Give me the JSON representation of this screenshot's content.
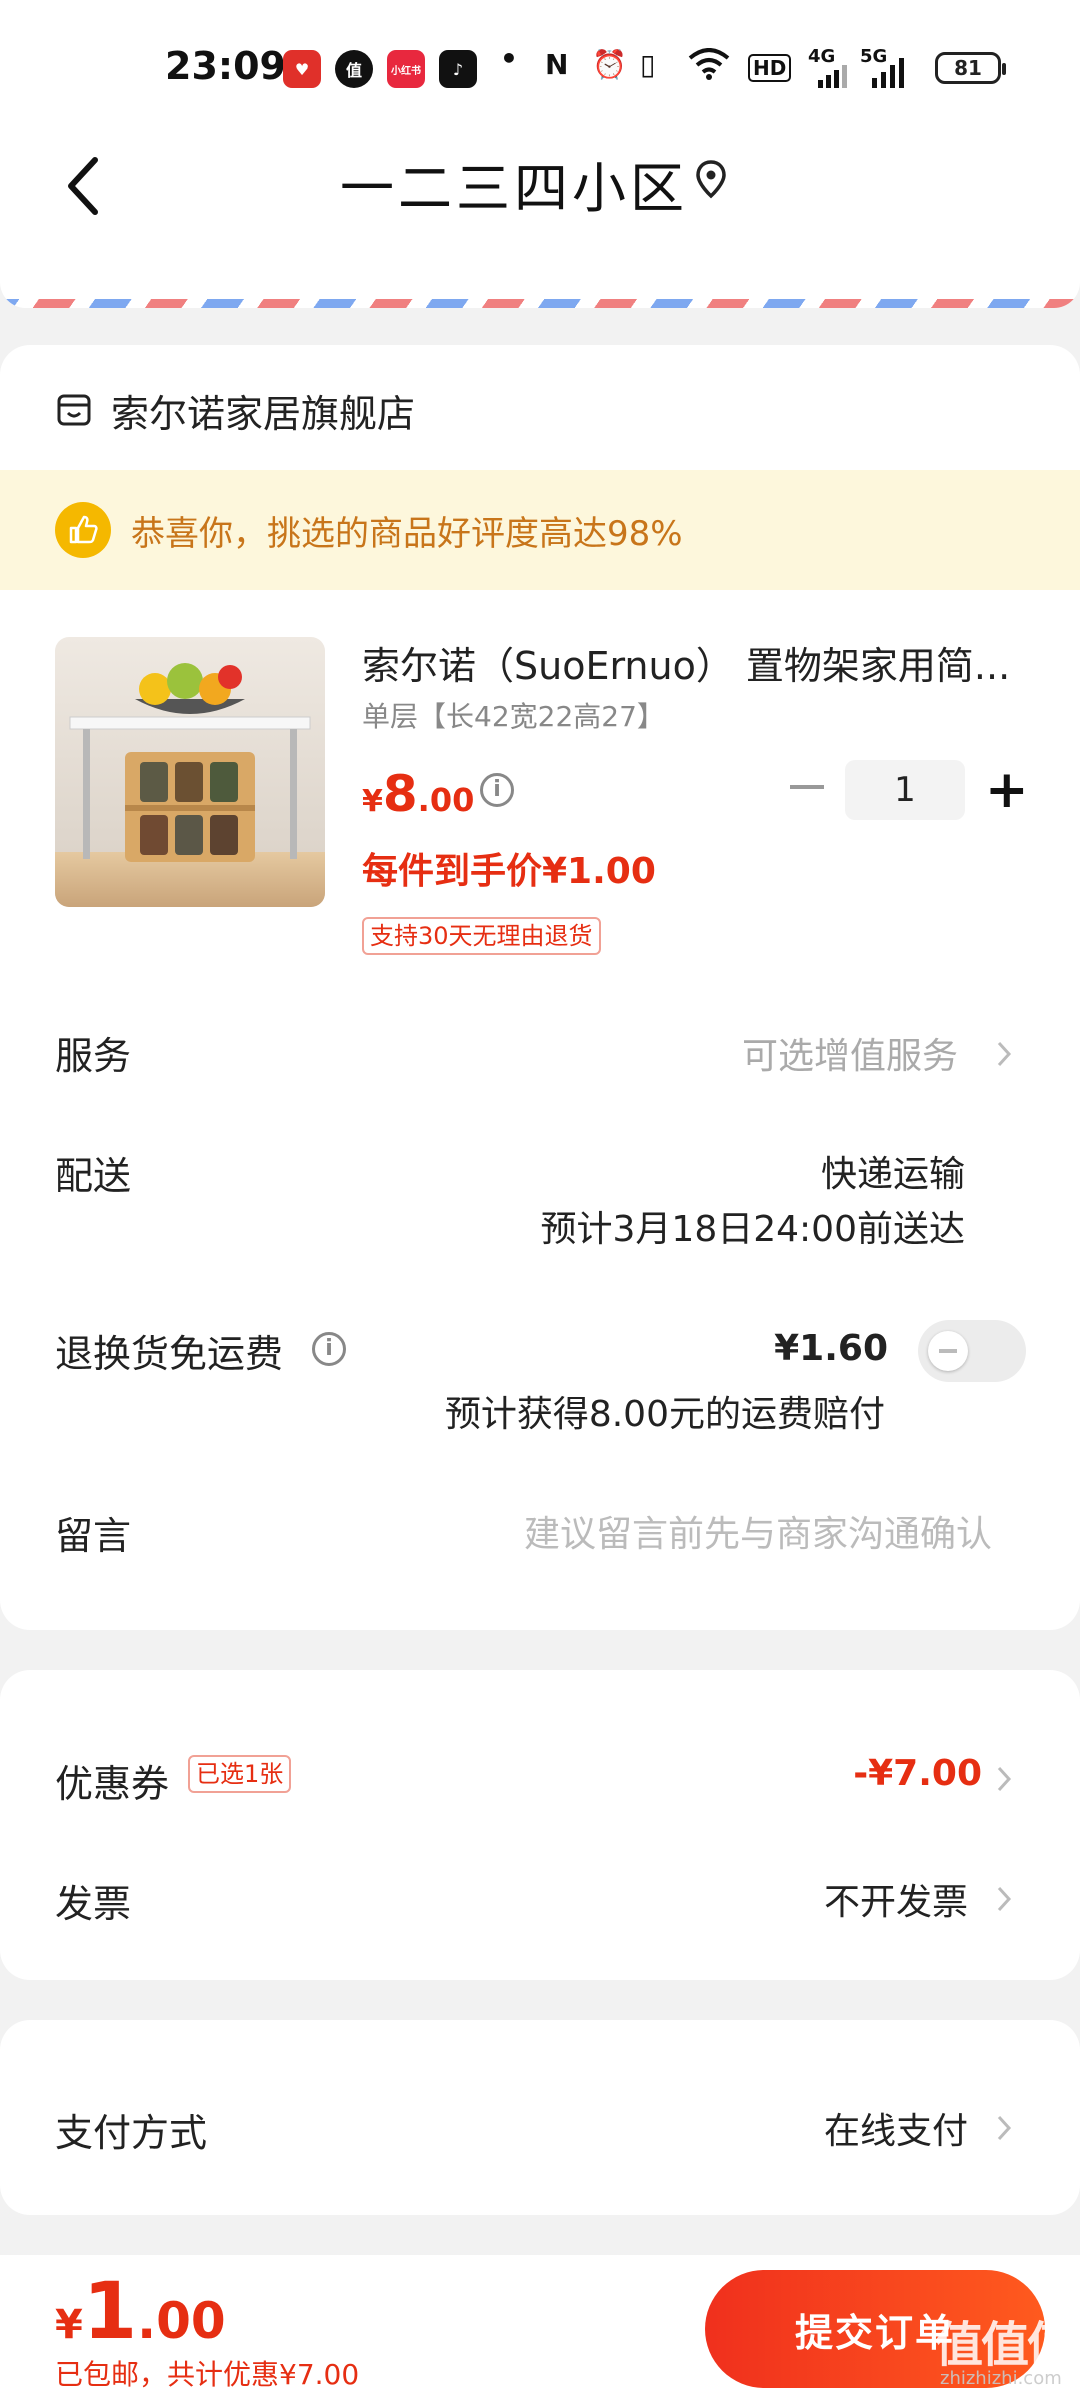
{
  "status_bar": {
    "time": "23:09",
    "apps": [
      "heart-app-icon",
      "zhi-app-icon",
      "xiaohongshu-app-icon",
      "tiktok-app-icon"
    ],
    "app_zhi_label": "值",
    "app_xhs_label": "小红书",
    "network_4g": "4G",
    "network_5g": "5G",
    "hd_label": "HD",
    "battery": "81"
  },
  "header": {
    "title": "一二三四小区"
  },
  "store": {
    "name": "索尔诺家居旗舰店",
    "praise": "恭喜你，挑选的商品好评度高达98%"
  },
  "product": {
    "title": "索尔诺（SuoErnuo） 置物架家用简...",
    "spec": "单层【长42宽22高27】",
    "price_symbol": "¥",
    "price_int": "8",
    "price_dec": ".00",
    "quantity": "1",
    "final_price": "每件到手价¥1.00",
    "return_tag": "支持30天无理由退货"
  },
  "rows": {
    "service_label": "服务",
    "service_value": "可选增值服务",
    "delivery_label": "配送",
    "delivery_method": "快递运输",
    "delivery_eta": "预计3月18日24:00前送达",
    "return_shipping_label": "退换货免运费",
    "return_shipping_price": "¥1.60",
    "return_shipping_note": "预计获得8.00元的运费赔付",
    "message_label": "留言",
    "message_placeholder": "建议留言前先与商家沟通确认"
  },
  "coupon": {
    "label": "优惠券",
    "selected_tag": "已选1张",
    "value": "-¥7.00",
    "invoice_label": "发票",
    "invoice_value": "不开发票"
  },
  "payment": {
    "label": "支付方式",
    "value": "在线支付"
  },
  "bottom": {
    "total_symbol": "¥",
    "total_int": "1",
    "total_dec": ".00",
    "note": "已包邮，共计优惠¥7.00",
    "submit": "提交订单",
    "watermark": "值值值",
    "watermark_sub": "zhizhizhi.com"
  },
  "colors": {
    "accent_red": "#e62e12",
    "praise_orange": "#c8751a",
    "praise_bg": "#fdf7dc",
    "thumb_yellow": "#f5b800"
  }
}
